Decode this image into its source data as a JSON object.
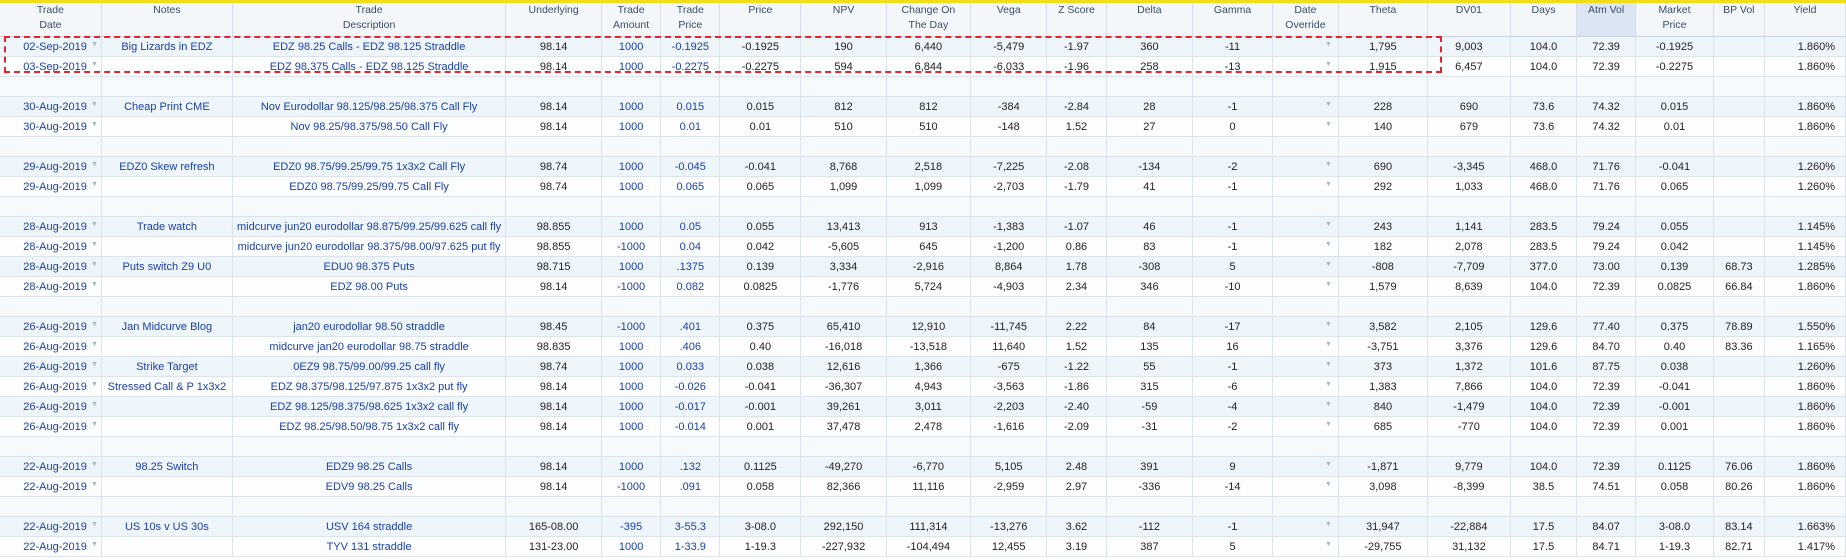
{
  "columns": [
    {
      "key": "trade_date",
      "label": "Trade\nDate"
    },
    {
      "key": "notes",
      "label": "Notes"
    },
    {
      "key": "trade_desc",
      "label": "Trade\nDescription"
    },
    {
      "key": "underlying",
      "label": "Underlying"
    },
    {
      "key": "trade_amount",
      "label": "Trade\nAmount"
    },
    {
      "key": "trade_price",
      "label": "Trade\nPrice"
    },
    {
      "key": "price",
      "label": "Price"
    },
    {
      "key": "npv",
      "label": "NPV"
    },
    {
      "key": "change_on_day",
      "label": "Change On\nThe Day"
    },
    {
      "key": "vega",
      "label": "Vega"
    },
    {
      "key": "z_score",
      "label": "Z Score"
    },
    {
      "key": "delta",
      "label": "Delta"
    },
    {
      "key": "gamma",
      "label": "Gamma"
    },
    {
      "key": "date_override",
      "label": "Date\nOverride"
    },
    {
      "key": "theta",
      "label": "Theta"
    },
    {
      "key": "dv01",
      "label": "DV01"
    },
    {
      "key": "days",
      "label": "Days"
    },
    {
      "key": "atm_vol",
      "label": "Atm Vol",
      "highlight": true
    },
    {
      "key": "market_price",
      "label": "Market\nPrice"
    },
    {
      "key": "bp_vol",
      "label": "BP Vol"
    },
    {
      "key": "yield",
      "label": "Yield"
    }
  ],
  "rows": [
    {
      "type": "data",
      "trade_date": "02-Sep-2019",
      "notes": "Big Lizards in EDZ",
      "trade_desc": "EDZ 98.25 Calls - EDZ 98.125 Straddle",
      "underlying": "98.14",
      "trade_amount": "1000",
      "trade_price": "-0.1925",
      "price": "-0.1925",
      "npv": "190",
      "change_on_day": "6,440",
      "vega": "-5,479",
      "z_score": "-1.97",
      "delta": "360",
      "gamma": "-11",
      "date_override": "",
      "theta": "1,795",
      "dv01": "9,003",
      "days": "104.0",
      "atm_vol": "72.39",
      "market_price": "-0.1925",
      "bp_vol": "",
      "yield": "1.860%"
    },
    {
      "type": "data",
      "trade_date": "03-Sep-2019",
      "notes": "",
      "trade_desc": "EDZ 98.375 Calls - EDZ 98.125 Straddle",
      "underlying": "98.14",
      "trade_amount": "1000",
      "trade_price": "-0.2275",
      "price": "-0.2275",
      "npv": "594",
      "change_on_day": "6,844",
      "vega": "-6,033",
      "z_score": "-1.96",
      "delta": "258",
      "gamma": "-13",
      "date_override": "",
      "theta": "1,915",
      "dv01": "6,457",
      "days": "104.0",
      "atm_vol": "72.39",
      "market_price": "-0.2275",
      "bp_vol": "",
      "yield": "1.860%"
    },
    {
      "type": "spacer"
    },
    {
      "type": "data",
      "trade_date": "30-Aug-2019",
      "notes": "Cheap Print CME",
      "trade_desc": "Nov Eurodollar 98.125/98.25/98.375 Call Fly",
      "underlying": "98.14",
      "trade_amount": "1000",
      "trade_price": "0.015",
      "price": "0.015",
      "npv": "812",
      "change_on_day": "812",
      "vega": "-384",
      "z_score": "-2.84",
      "delta": "28",
      "gamma": "-1",
      "date_override": "",
      "theta": "228",
      "dv01": "690",
      "days": "73.6",
      "atm_vol": "74.32",
      "market_price": "0.015",
      "bp_vol": "",
      "yield": "1.860%"
    },
    {
      "type": "data",
      "trade_date": "30-Aug-2019",
      "notes": "",
      "trade_desc": "Nov 98.25/98.375/98.50 Call Fly",
      "underlying": "98.14",
      "trade_amount": "1000",
      "trade_price": "0.01",
      "price": "0.01",
      "npv": "510",
      "change_on_day": "510",
      "vega": "-148",
      "z_score": "1.52",
      "delta": "27",
      "gamma": "0",
      "date_override": "",
      "theta": "140",
      "dv01": "679",
      "days": "73.6",
      "atm_vol": "74.32",
      "market_price": "0.01",
      "bp_vol": "",
      "yield": "1.860%"
    },
    {
      "type": "spacer"
    },
    {
      "type": "data",
      "trade_date": "29-Aug-2019",
      "notes": "EDZ0 Skew refresh",
      "trade_desc": "EDZ0 98.75/99.25/99.75 1x3x2 Call Fly",
      "underlying": "98.74",
      "trade_amount": "1000",
      "trade_price": "-0.045",
      "price": "-0.041",
      "npv": "8,768",
      "change_on_day": "2,518",
      "vega": "-7,225",
      "z_score": "-2.08",
      "delta": "-134",
      "gamma": "-2",
      "date_override": "",
      "theta": "690",
      "dv01": "-3,345",
      "days": "468.0",
      "atm_vol": "71.76",
      "market_price": "-0.041",
      "bp_vol": "",
      "yield": "1.260%"
    },
    {
      "type": "data",
      "trade_date": "29-Aug-2019",
      "notes": "",
      "trade_desc": "EDZ0 98.75/99.25/99.75 Call Fly",
      "underlying": "98.74",
      "trade_amount": "1000",
      "trade_price": "0.065",
      "price": "0.065",
      "npv": "1,099",
      "change_on_day": "1,099",
      "vega": "-2,703",
      "z_score": "-1.79",
      "delta": "41",
      "gamma": "-1",
      "date_override": "",
      "theta": "292",
      "dv01": "1,033",
      "days": "468.0",
      "atm_vol": "71.76",
      "market_price": "0.065",
      "bp_vol": "",
      "yield": "1.260%"
    },
    {
      "type": "spacer"
    },
    {
      "type": "data",
      "trade_date": "28-Aug-2019",
      "notes": "Trade watch",
      "trade_desc": "midcurve jun20 eurodollar 98.875/99.25/99.625 call fly",
      "underlying": "98.855",
      "trade_amount": "1000",
      "trade_price": "0.05",
      "price": "0.055",
      "npv": "13,413",
      "change_on_day": "913",
      "vega": "-1,383",
      "z_score": "-1.07",
      "delta": "46",
      "gamma": "-1",
      "date_override": "",
      "theta": "243",
      "dv01": "1,141",
      "days": "283.5",
      "atm_vol": "79.24",
      "market_price": "0.055",
      "bp_vol": "",
      "yield": "1.145%"
    },
    {
      "type": "data",
      "trade_date": "28-Aug-2019",
      "notes": "",
      "trade_desc": "midcurve jun20 eurodollar 98.375/98.00/97.625 put fly",
      "underlying": "98.855",
      "trade_amount": "-1000",
      "trade_price": "0.04",
      "price": "0.042",
      "npv": "-5,605",
      "change_on_day": "645",
      "vega": "-1,200",
      "z_score": "0.86",
      "delta": "83",
      "gamma": "-1",
      "date_override": "",
      "theta": "182",
      "dv01": "2,078",
      "days": "283.5",
      "atm_vol": "79.24",
      "market_price": "0.042",
      "bp_vol": "",
      "yield": "1.145%"
    },
    {
      "type": "data",
      "trade_date": "28-Aug-2019",
      "notes": "Puts switch Z9 U0",
      "trade_desc": "EDU0 98.375 Puts",
      "underlying": "98.715",
      "trade_amount": "1000",
      "trade_price": ".1375",
      "price": "0.139",
      "npv": "3,334",
      "change_on_day": "-2,916",
      "vega": "8,864",
      "z_score": "1.78",
      "delta": "-308",
      "gamma": "5",
      "date_override": "",
      "theta": "-808",
      "dv01": "-7,709",
      "days": "377.0",
      "atm_vol": "73.00",
      "market_price": "0.139",
      "bp_vol": "68.73",
      "yield": "1.285%"
    },
    {
      "type": "data",
      "trade_date": "28-Aug-2019",
      "notes": "",
      "trade_desc": "EDZ 98.00 Puts",
      "underlying": "98.14",
      "trade_amount": "-1000",
      "trade_price": "0.082",
      "price": "0.0825",
      "npv": "-1,776",
      "change_on_day": "5,724",
      "vega": "-4,903",
      "z_score": "2.34",
      "delta": "346",
      "gamma": "-10",
      "date_override": "",
      "theta": "1,579",
      "dv01": "8,639",
      "days": "104.0",
      "atm_vol": "72.39",
      "market_price": "0.0825",
      "bp_vol": "66.84",
      "yield": "1.860%"
    },
    {
      "type": "spacer"
    },
    {
      "type": "data",
      "trade_date": "26-Aug-2019",
      "notes": "Jan Midcurve Blog",
      "trade_desc": "jan20 eurodollar 98.50 straddle",
      "underlying": "98.45",
      "trade_amount": "-1000",
      "trade_price": ".401",
      "price": "0.375",
      "npv": "65,410",
      "change_on_day": "12,910",
      "vega": "-11,745",
      "z_score": "2.22",
      "delta": "84",
      "gamma": "-17",
      "date_override": "",
      "theta": "3,582",
      "dv01": "2,105",
      "days": "129.6",
      "atm_vol": "77.40",
      "market_price": "0.375",
      "bp_vol": "78.89",
      "yield": "1.550%"
    },
    {
      "type": "data",
      "trade_date": "26-Aug-2019",
      "notes": "",
      "trade_desc": "midcurve jan20 eurodollar 98.75 straddle",
      "underlying": "98.835",
      "trade_amount": "1000",
      "trade_price": ".406",
      "price": "0.40",
      "npv": "-16,018",
      "change_on_day": "-13,518",
      "vega": "11,640",
      "z_score": "1.52",
      "delta": "135",
      "gamma": "16",
      "date_override": "",
      "theta": "-3,751",
      "dv01": "3,376",
      "days": "129.6",
      "atm_vol": "84.70",
      "market_price": "0.40",
      "bp_vol": "83.36",
      "yield": "1.165%"
    },
    {
      "type": "data",
      "trade_date": "26-Aug-2019",
      "notes": "Strike Target",
      "trade_desc": "0EZ9 98.75/99.00/99.25 call fly",
      "underlying": "98.74",
      "trade_amount": "1000",
      "trade_price": "0.033",
      "price": "0.038",
      "npv": "12,616",
      "change_on_day": "1,366",
      "vega": "-675",
      "z_score": "-1.22",
      "delta": "55",
      "gamma": "-1",
      "date_override": "",
      "theta": "373",
      "dv01": "1,372",
      "days": "101.6",
      "atm_vol": "87.75",
      "market_price": "0.038",
      "bp_vol": "",
      "yield": "1.260%"
    },
    {
      "type": "data",
      "trade_date": "26-Aug-2019",
      "notes": "Stressed Call & P 1x3x2",
      "trade_desc": "EDZ 98.375/98.125/97.875 1x3x2 put fly",
      "underlying": "98.14",
      "trade_amount": "1000",
      "trade_price": "-0.026",
      "price": "-0.041",
      "npv": "-36,307",
      "change_on_day": "4,943",
      "vega": "-3,563",
      "z_score": "-1.86",
      "delta": "315",
      "gamma": "-6",
      "date_override": "",
      "theta": "1,383",
      "dv01": "7,866",
      "days": "104.0",
      "atm_vol": "72.39",
      "market_price": "-0.041",
      "bp_vol": "",
      "yield": "1.860%"
    },
    {
      "type": "data",
      "trade_date": "26-Aug-2019",
      "notes": "",
      "trade_desc": "EDZ 98.125/98.375/98.625 1x3x2 call fly",
      "underlying": "98.14",
      "trade_amount": "1000",
      "trade_price": "-0.017",
      "price": "-0.001",
      "npv": "39,261",
      "change_on_day": "3,011",
      "vega": "-2,203",
      "z_score": "-2.40",
      "delta": "-59",
      "gamma": "-4",
      "date_override": "",
      "theta": "840",
      "dv01": "-1,479",
      "days": "104.0",
      "atm_vol": "72.39",
      "market_price": "-0.001",
      "bp_vol": "",
      "yield": "1.860%"
    },
    {
      "type": "data",
      "trade_date": "26-Aug-2019",
      "notes": "",
      "trade_desc": "EDZ 98.25/98.50/98.75 1x3x2 call fly",
      "underlying": "98.14",
      "trade_amount": "1000",
      "trade_price": "-0.014",
      "price": "0.001",
      "npv": "37,478",
      "change_on_day": "2,478",
      "vega": "-1,616",
      "z_score": "-2.09",
      "delta": "-31",
      "gamma": "-2",
      "date_override": "",
      "theta": "685",
      "dv01": "-770",
      "days": "104.0",
      "atm_vol": "72.39",
      "market_price": "0.001",
      "bp_vol": "",
      "yield": "1.860%"
    },
    {
      "type": "spacer"
    },
    {
      "type": "data",
      "trade_date": "22-Aug-2019",
      "notes": "98.25 Switch",
      "trade_desc": "EDZ9 98.25 Calls",
      "underlying": "98.14",
      "trade_amount": "1000",
      "trade_price": ".132",
      "price": "0.1125",
      "npv": "-49,270",
      "change_on_day": "-6,770",
      "vega": "5,105",
      "z_score": "2.48",
      "delta": "391",
      "gamma": "9",
      "date_override": "",
      "theta": "-1,871",
      "dv01": "9,779",
      "days": "104.0",
      "atm_vol": "72.39",
      "market_price": "0.1125",
      "bp_vol": "76.06",
      "yield": "1.860%"
    },
    {
      "type": "data",
      "trade_date": "22-Aug-2019",
      "notes": "",
      "trade_desc": "EDV9 98.25 Calls",
      "underlying": "98.14",
      "trade_amount": "-1000",
      "trade_price": ".091",
      "price": "0.058",
      "npv": "82,366",
      "change_on_day": "11,116",
      "vega": "-2,959",
      "z_score": "2.97",
      "delta": "-336",
      "gamma": "-14",
      "date_override": "",
      "theta": "3,098",
      "dv01": "-8,399",
      "days": "38.5",
      "atm_vol": "74.51",
      "market_price": "0.058",
      "bp_vol": "80.26",
      "yield": "1.860%"
    },
    {
      "type": "spacer"
    },
    {
      "type": "data",
      "trade_date": "22-Aug-2019",
      "notes": "US 10s v US 30s",
      "trade_desc": "USV 164 straddle",
      "underlying": "165-08.00",
      "trade_amount": "-395",
      "trade_price": "3-55.3",
      "price": "3-08.0",
      "npv": "292,150",
      "change_on_day": "111,314",
      "vega": "-13,276",
      "z_score": "3.62",
      "delta": "-112",
      "gamma": "-1",
      "date_override": "",
      "theta": "31,947",
      "dv01": "-22,884",
      "days": "17.5",
      "atm_vol": "84.07",
      "market_price": "3-08.0",
      "bp_vol": "83.14",
      "yield": "1.663%"
    },
    {
      "type": "data",
      "trade_date": "22-Aug-2019",
      "notes": "",
      "trade_desc": "TYV 131 straddle",
      "underlying": "131-23.00",
      "trade_amount": "1000",
      "trade_price": "1-33.9",
      "price": "1-19.3",
      "npv": "-227,932",
      "change_on_day": "-104,494",
      "vega": "12,455",
      "z_score": "3.19",
      "delta": "387",
      "gamma": "5",
      "date_override": "",
      "theta": "-29,755",
      "dv01": "31,132",
      "days": "17.5",
      "atm_vol": "84.71",
      "market_price": "1-19.3",
      "bp_vol": "82.71",
      "yield": "1.417%"
    }
  ],
  "colors": {
    "header_top_border": "#f2dd1a",
    "selection_border": "#e4232a",
    "link_text": "#1a3fa8",
    "row_alt": "#eef5fb",
    "atm_vol_header": "#dbe5f3"
  },
  "icons": {
    "row_dropdown": "chevron-down-icon"
  }
}
